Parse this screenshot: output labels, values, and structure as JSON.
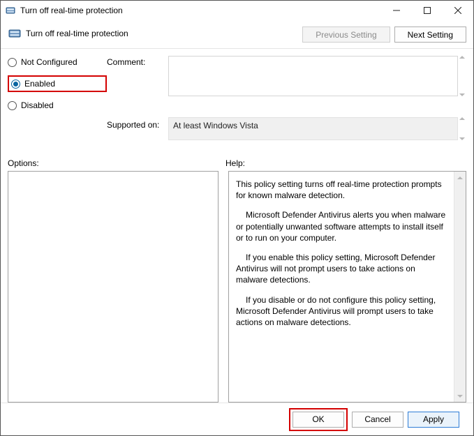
{
  "window": {
    "title": "Turn off real-time protection"
  },
  "header": {
    "title": "Turn off real-time protection",
    "previous": "Previous Setting",
    "next": "Next Setting"
  },
  "state": {
    "not_configured": "Not Configured",
    "enabled": "Enabled",
    "disabled": "Disabled",
    "selected": "enabled"
  },
  "fields": {
    "comment_label": "Comment:",
    "comment_value": "",
    "supported_label": "Supported on:",
    "supported_value": "At least Windows Vista"
  },
  "sections": {
    "options": "Options:",
    "help": "Help:"
  },
  "help_text": {
    "p1": "This policy setting turns off real-time protection prompts for known malware detection.",
    "p2": "Microsoft Defender Antivirus alerts you when malware or potentially unwanted software attempts to install itself or to run on your computer.",
    "p3": "If you enable this policy setting, Microsoft Defender Antivirus will not prompt users to take actions on malware detections.",
    "p4": "If you disable or do not configure this policy setting, Microsoft Defender Antivirus will prompt users to take actions on malware detections."
  },
  "footer": {
    "ok": "OK",
    "cancel": "Cancel",
    "apply": "Apply"
  }
}
